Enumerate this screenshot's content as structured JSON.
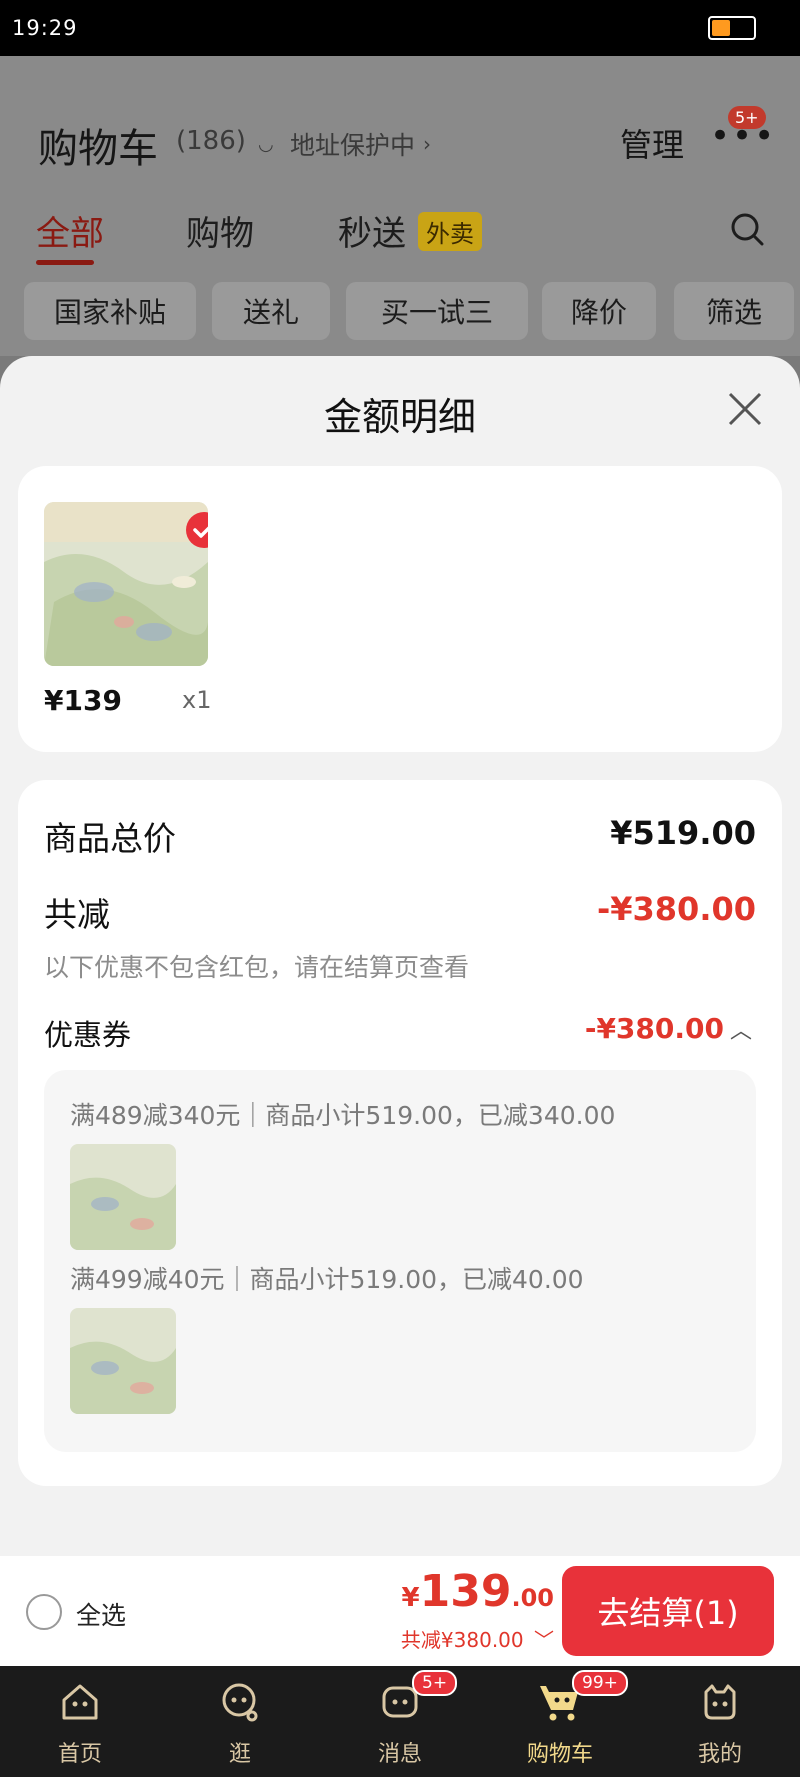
{
  "status_bar": {
    "time": "19:29",
    "battery_level": 0.45
  },
  "header": {
    "title": "购物车",
    "count": "(186)",
    "address_label": "地址保护中",
    "manage_label": "管理",
    "more_badge": "5+"
  },
  "tabs": [
    {
      "label": "全部"
    },
    {
      "label": "购物"
    },
    {
      "label": "秒送"
    }
  ],
  "tab_tag": "外卖",
  "chips": [
    "国家补贴",
    "送礼",
    "买一试三",
    "降价",
    "筛选"
  ],
  "sheet": {
    "title": "金额明细",
    "product": {
      "price": "¥139",
      "qty": "x1"
    },
    "total_label": "商品总价",
    "total_value": "¥519.00",
    "discount_label": "共减",
    "discount_value": "-¥380.00",
    "note": "以下优惠不包含红包，请在结算页查看",
    "coupon_label": "优惠券",
    "coupon_value": "-¥380.00",
    "coupons": [
      {
        "text": "满489减340元｜商品小计519.00，已减340.00"
      },
      {
        "text": "满499减40元｜商品小计519.00，已减40.00"
      }
    ]
  },
  "bottom": {
    "select_all": "全选",
    "price_symbol": "¥",
    "price_int": "139",
    "price_dec": ".00",
    "saved": "共减¥380.00",
    "checkout": "去结算(1)"
  },
  "nav": [
    {
      "label": "首页",
      "icon": "home-icon"
    },
    {
      "label": "逛",
      "icon": "browse-icon"
    },
    {
      "label": "消息",
      "icon": "message-icon",
      "badge": "5+"
    },
    {
      "label": "购物车",
      "icon": "cart-icon",
      "badge": "99+"
    },
    {
      "label": "我的",
      "icon": "profile-icon"
    }
  ],
  "colors": {
    "accent": "#e8323a",
    "price_red": "#e0362b",
    "nav_bg": "#1b1b1b",
    "nav_text": "#d9c7a5"
  }
}
